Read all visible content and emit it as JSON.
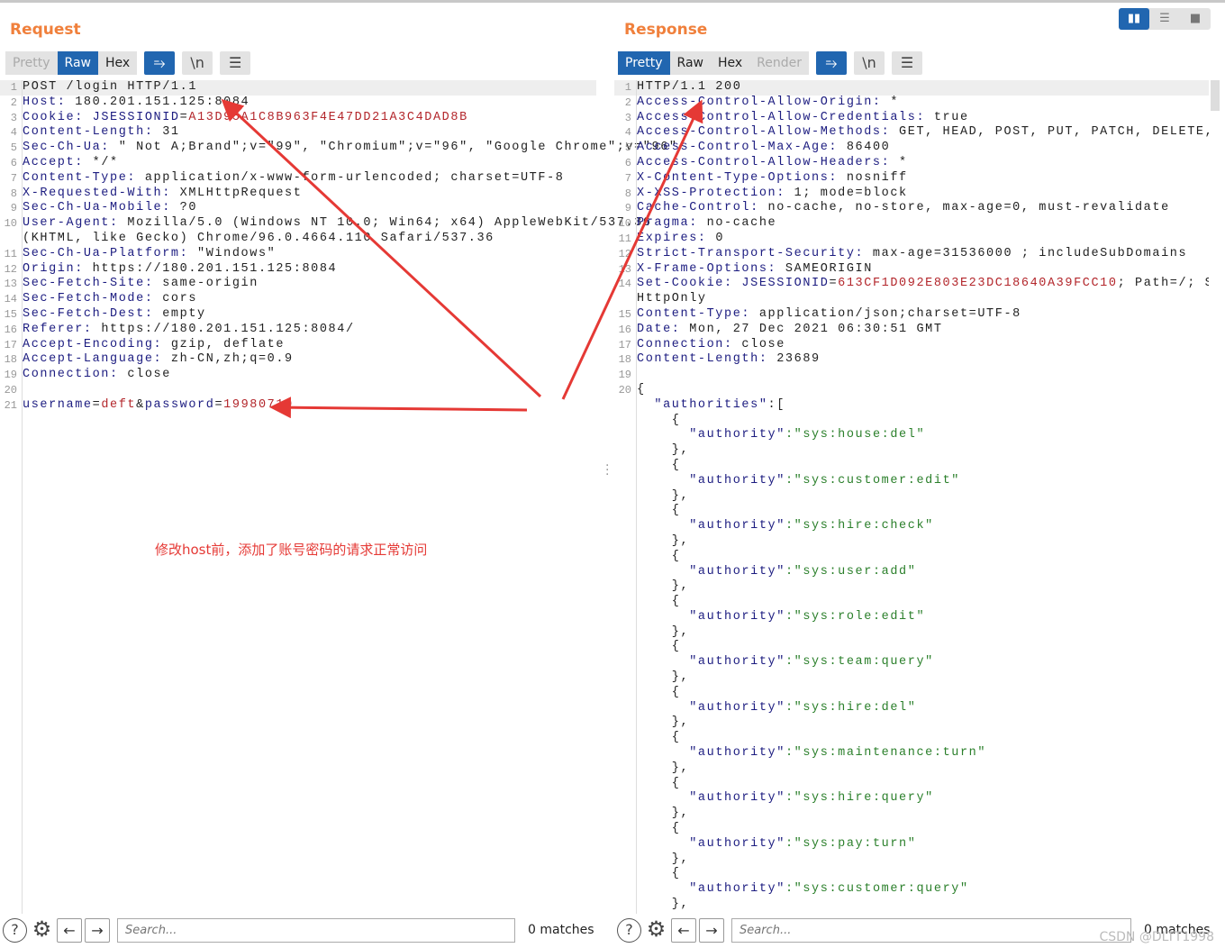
{
  "request": {
    "title": "Request",
    "tabs": [
      "Pretty",
      "Raw",
      "Hex"
    ],
    "active_tab": "Raw",
    "lines": [
      {
        "n": "1",
        "s": [
          [
            "POST /login HTTP/1.1",
            "v"
          ]
        ]
      },
      {
        "n": "2",
        "s": [
          [
            "Host:",
            "k"
          ],
          [
            " 180.201.151.125:8084",
            "v"
          ]
        ]
      },
      {
        "n": "3",
        "s": [
          [
            "Cookie:",
            "k"
          ],
          [
            " JSESSIONID",
            "k"
          ],
          [
            "=",
            "v"
          ],
          [
            "A13D95A1C8B963F4E47DD21A3C4DAD8B",
            "r"
          ]
        ]
      },
      {
        "n": "4",
        "s": [
          [
            "Content-Length:",
            "k"
          ],
          [
            " 31",
            "v"
          ]
        ]
      },
      {
        "n": "5",
        "s": [
          [
            "Sec-Ch-Ua:",
            "k"
          ],
          [
            " \" Not A;Brand\";v=\"99\", \"Chromium\";v=\"96\", \"Google Chrome\";v=\"96\"",
            "v"
          ]
        ]
      },
      {
        "n": "6",
        "s": [
          [
            "Accept:",
            "k"
          ],
          [
            " */*",
            "v"
          ]
        ]
      },
      {
        "n": "7",
        "s": [
          [
            "Content-Type:",
            "k"
          ],
          [
            " application/x-www-form-urlencoded; charset=UTF-8",
            "v"
          ]
        ]
      },
      {
        "n": "8",
        "s": [
          [
            "X-Requested-With:",
            "k"
          ],
          [
            " XMLHttpRequest",
            "v"
          ]
        ]
      },
      {
        "n": "9",
        "s": [
          [
            "Sec-Ch-Ua-Mobile:",
            "k"
          ],
          [
            " ?0",
            "v"
          ]
        ]
      },
      {
        "n": "10",
        "s": [
          [
            "User-Agent:",
            "k"
          ],
          [
            " Mozilla/5.0 (Windows NT 10.0; Win64; x64) AppleWebKit/537.36",
            "v"
          ]
        ]
      },
      {
        "n": "",
        "s": [
          [
            "(KHTML, like Gecko) Chrome/96.0.4664.110 Safari/537.36",
            "v"
          ]
        ]
      },
      {
        "n": "11",
        "s": [
          [
            "Sec-Ch-Ua-Platform:",
            "k"
          ],
          [
            " \"Windows\"",
            "v"
          ]
        ]
      },
      {
        "n": "12",
        "s": [
          [
            "Origin:",
            "k"
          ],
          [
            " https://180.201.151.125:8084",
            "v"
          ]
        ]
      },
      {
        "n": "13",
        "s": [
          [
            "Sec-Fetch-Site:",
            "k"
          ],
          [
            " same-origin",
            "v"
          ]
        ]
      },
      {
        "n": "14",
        "s": [
          [
            "Sec-Fetch-Mode:",
            "k"
          ],
          [
            " cors",
            "v"
          ]
        ]
      },
      {
        "n": "15",
        "s": [
          [
            "Sec-Fetch-Dest:",
            "k"
          ],
          [
            " empty",
            "v"
          ]
        ]
      },
      {
        "n": "16",
        "s": [
          [
            "Referer:",
            "k"
          ],
          [
            " https://180.201.151.125:8084/",
            "v"
          ]
        ]
      },
      {
        "n": "17",
        "s": [
          [
            "Accept-Encoding:",
            "k"
          ],
          [
            " gzip, deflate",
            "v"
          ]
        ]
      },
      {
        "n": "18",
        "s": [
          [
            "Accept-Language:",
            "k"
          ],
          [
            " zh-CN,zh;q=0.9",
            "v"
          ]
        ]
      },
      {
        "n": "19",
        "s": [
          [
            "Connection:",
            "k"
          ],
          [
            " close",
            "v"
          ]
        ]
      },
      {
        "n": "20",
        "s": []
      },
      {
        "n": "21",
        "s": [
          [
            "username",
            "k"
          ],
          [
            "=",
            "v"
          ],
          [
            "deft",
            "r"
          ],
          [
            "&",
            "v"
          ],
          [
            "password",
            "k"
          ],
          [
            "=",
            "v"
          ],
          [
            "19980710",
            "r"
          ]
        ]
      }
    ],
    "search_placeholder": "Search...",
    "matches": "0 matches",
    "annotation": "修改host前，添加了账号密码的请求正常访问"
  },
  "response": {
    "title": "Response",
    "tabs": [
      "Pretty",
      "Raw",
      "Hex",
      "Render"
    ],
    "active_tab": "Pretty",
    "lines": [
      {
        "n": "1",
        "s": [
          [
            "HTTP/1.1 200",
            "v"
          ]
        ]
      },
      {
        "n": "2",
        "s": [
          [
            "Access-Control-Allow-Origin:",
            "k"
          ],
          [
            " *",
            "v"
          ]
        ]
      },
      {
        "n": "3",
        "s": [
          [
            "Access-Control-Allow-Credentials:",
            "k"
          ],
          [
            " true",
            "v"
          ]
        ]
      },
      {
        "n": "4",
        "s": [
          [
            "Access-Control-Allow-Methods:",
            "k"
          ],
          [
            " GET, HEAD, POST, PUT, PATCH, DELETE, OPTIONS",
            "v"
          ]
        ]
      },
      {
        "n": "5",
        "s": [
          [
            "Access-Control-Max-Age:",
            "k"
          ],
          [
            " 86400",
            "v"
          ]
        ]
      },
      {
        "n": "6",
        "s": [
          [
            "Access-Control-Allow-Headers:",
            "k"
          ],
          [
            " *",
            "v"
          ]
        ]
      },
      {
        "n": "7",
        "s": [
          [
            "X-Content-Type-Options:",
            "k"
          ],
          [
            " nosniff",
            "v"
          ]
        ]
      },
      {
        "n": "8",
        "s": [
          [
            "X-XSS-Protection:",
            "k"
          ],
          [
            " 1; mode=block",
            "v"
          ]
        ]
      },
      {
        "n": "9",
        "s": [
          [
            "Cache-Control:",
            "k"
          ],
          [
            " no-cache, no-store, max-age=0, must-revalidate",
            "v"
          ]
        ]
      },
      {
        "n": "10",
        "s": [
          [
            "Pragma:",
            "k"
          ],
          [
            " no-cache",
            "v"
          ]
        ]
      },
      {
        "n": "11",
        "s": [
          [
            "Expires:",
            "k"
          ],
          [
            " 0",
            "v"
          ]
        ]
      },
      {
        "n": "12",
        "s": [
          [
            "Strict-Transport-Security:",
            "k"
          ],
          [
            " max-age=31536000 ; includeSubDomains",
            "v"
          ]
        ]
      },
      {
        "n": "13",
        "s": [
          [
            "X-Frame-Options:",
            "k"
          ],
          [
            " SAMEORIGIN",
            "v"
          ]
        ]
      },
      {
        "n": "14",
        "s": [
          [
            "Set-Cookie:",
            "k"
          ],
          [
            " JSESSIONID",
            "k"
          ],
          [
            "=",
            "v"
          ],
          [
            "613CF1D092E803E23DC18640A39FCC10",
            "r"
          ],
          [
            "; Path=/; Secure;",
            "v"
          ]
        ]
      },
      {
        "n": "",
        "s": [
          [
            "HttpOnly",
            "v"
          ]
        ]
      },
      {
        "n": "15",
        "s": [
          [
            "Content-Type:",
            "k"
          ],
          [
            " application/json;charset=UTF-8",
            "v"
          ]
        ]
      },
      {
        "n": "16",
        "s": [
          [
            "Date:",
            "k"
          ],
          [
            " Mon, 27 Dec 2021 06:30:51 GMT",
            "v"
          ]
        ]
      },
      {
        "n": "17",
        "s": [
          [
            "Connection:",
            "k"
          ],
          [
            " close",
            "v"
          ]
        ]
      },
      {
        "n": "18",
        "s": [
          [
            "Content-Length:",
            "k"
          ],
          [
            " 23689",
            "v"
          ]
        ]
      },
      {
        "n": "19",
        "s": []
      },
      {
        "n": "20",
        "s": [
          [
            "{",
            "v"
          ]
        ]
      },
      {
        "n": "",
        "s": [
          [
            "  \"authorities\"",
            "k"
          ],
          [
            ":[",
            "v"
          ]
        ]
      }
    ],
    "authority_key": "\"authority\"",
    "authorities": [
      "sys:house:del",
      "sys:customer:edit",
      "sys:hire:check",
      "sys:user:add",
      "sys:role:edit",
      "sys:team:query",
      "sys:hire:del",
      "sys:maintenance:turn",
      "sys:hire:query",
      "sys:pay:turn",
      "sys:customer:query"
    ],
    "search_placeholder": "Search...",
    "matches": "0 matches"
  },
  "icons": {
    "wrap": "⥱",
    "newline": "\\n",
    "menu": "☰",
    "help": "?",
    "settings": "⚙",
    "back": "←",
    "forward": "→"
  },
  "watermark": "CSDN @DLTT1998",
  "colors": {
    "accent": "#2166b0",
    "title": "#f0803c",
    "annotation": "#e53935"
  }
}
